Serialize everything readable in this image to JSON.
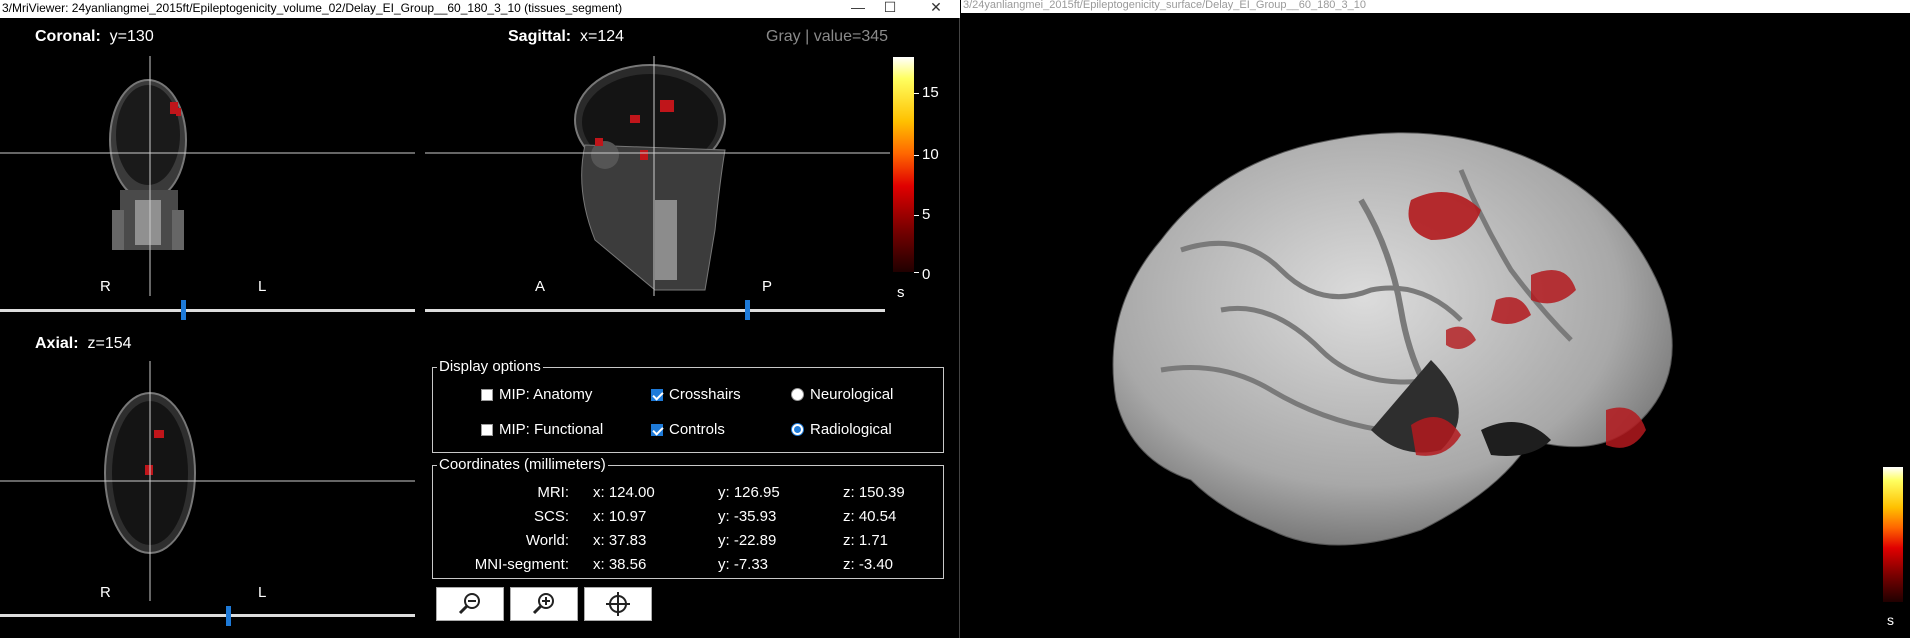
{
  "viewer": {
    "title": "3/MriViewer: 24yanliangmei_2015ft/Epileptogenicity_volume_02/Delay_EI_Group__60_180_3_10 (tissues_segment)",
    "coronal": {
      "name": "Coronal:",
      "coord": "y=130",
      "left": "R",
      "right": "L"
    },
    "sagittal": {
      "name": "Sagittal:",
      "coord": "x=124",
      "left": "A",
      "right": "P"
    },
    "axial": {
      "name": "Axial:",
      "coord": "z=154",
      "left": "R",
      "right": "L"
    },
    "colormap_info": "Gray  |  value=345",
    "colorbar": {
      "ticks": [
        "15",
        "10",
        "5",
        "0"
      ],
      "unit": "s",
      "max": 18,
      "min": 0
    },
    "display_options": {
      "title": "Display options",
      "mip_anatomy": "MIP: Anatomy",
      "mip_functional": "MIP: Functional",
      "crosshairs": "Crosshairs",
      "controls": "Controls",
      "neurological": "Neurological",
      "radiological": "Radiological",
      "state": {
        "mip_anatomy": false,
        "mip_functional": false,
        "crosshairs": true,
        "controls": true,
        "orientation": "radiological"
      }
    },
    "coordinates": {
      "title": "Coordinates (millimeters)",
      "rows": [
        {
          "label": "MRI:",
          "x": "x: 124.00",
          "y": "y: 126.95",
          "z": "z: 150.39"
        },
        {
          "label": "SCS:",
          "x": "x: 10.97",
          "y": "y: -35.93",
          "z": "z: 40.54"
        },
        {
          "label": "World:",
          "x": "x: 37.83",
          "y": "y: -22.89",
          "z": "z: 1.71"
        },
        {
          "label": "MNI-segment:",
          "x": "x: 38.56",
          "y": "y: -7.33",
          "z": "z: -3.40"
        }
      ]
    },
    "tools": [
      "zoom-out-icon",
      "zoom-in-icon",
      "crosshair-target-icon"
    ],
    "sliders": {
      "coronal": 0.44,
      "sagittal": 0.7,
      "axial": 0.55
    }
  },
  "surface": {
    "title": "3/24yanliangmei_2015ft/Epileptogenicity_surface/Delay_EI_Group__60_180_3_10",
    "unit": "s"
  },
  "colors": {
    "accent": "#1e7ad8",
    "activation": "#c0151a",
    "cortex": "#b8b8b8"
  }
}
